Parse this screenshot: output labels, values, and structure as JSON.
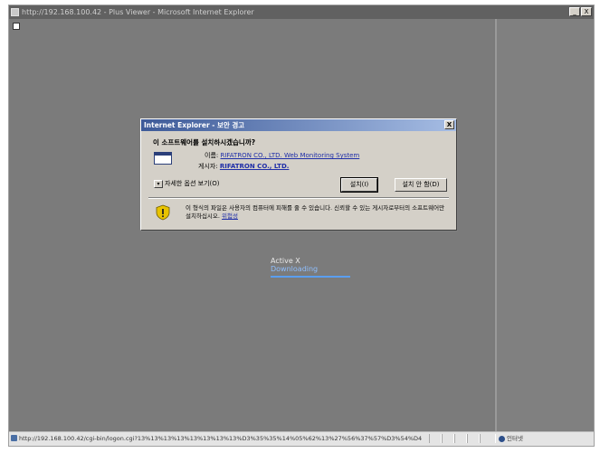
{
  "window": {
    "title": "http://192.168.100.42 - Plus Viewer - Microsoft Internet Explorer",
    "buttons": [
      "_",
      "X"
    ]
  },
  "dialog": {
    "title": "Internet Explorer - 보안 경고",
    "close_label": "X",
    "question": "이 소프트웨어를 설치하시겠습니까?",
    "name_label": "이름:",
    "name_value": "RIFATRON CO., LTD. Web Monitoring System",
    "publisher_label": "게시자:",
    "publisher_value": "RIFATRON CO., LTD.",
    "more_options_arrow": "▾",
    "more_options_label": "자세한 옵션 보기(O)",
    "install_button": "설치(I)",
    "dont_install_button": "설치 안 함(D)",
    "warning_text": "이 형식의 파일은 사용자의 컴퓨터에 피해를 줄 수 있습니다. 신뢰할 수 있는 게시자로부터의 소프트웨어만 설치하십시오.",
    "warning_link": "위험성"
  },
  "activex": {
    "label": "Active X",
    "status": "Downloading",
    "progress": 1.0
  },
  "status_bar": {
    "url": "http://192.168.100.42/cgi-bin/logon.cgi?13%13%13%13%13%13%13%13%D3%35%35%14%05%62%13%27%56%37%57%D3%54%D4",
    "zone": "인터넷"
  },
  "colors": {
    "link": "#1f2ea8",
    "progress": "#5a9ef0",
    "title_gradient_start": "#3d5a98"
  }
}
